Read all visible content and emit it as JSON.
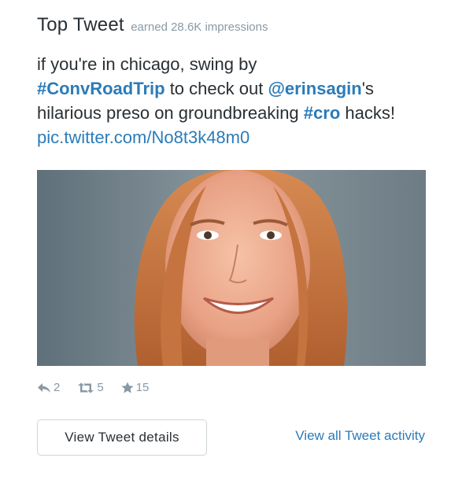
{
  "header": {
    "title": "Top Tweet",
    "earned": "earned 28.6K impressions"
  },
  "tweet": {
    "text_1": "if you're in chicago, swing by",
    "hashtag_1": "#ConvRoadTrip",
    "text_2": " to check out ",
    "mention": "@erinsagin",
    "text_3": "'s hilarious preso on groundbreaking ",
    "hashtag_2": "#cro",
    "text_4": " hacks! ",
    "pic_link": "pic.twitter.com/No8t3k48m0"
  },
  "photo": {
    "description_icon": "portrait-photo"
  },
  "stats": {
    "replies": "2",
    "retweets": "5",
    "favorites": "15"
  },
  "actions": {
    "details_label": "View Tweet details",
    "activity_label": "View all Tweet activity"
  },
  "colors": {
    "link": "#2b7bb9",
    "muted": "#8899a6",
    "text": "#292f33"
  }
}
